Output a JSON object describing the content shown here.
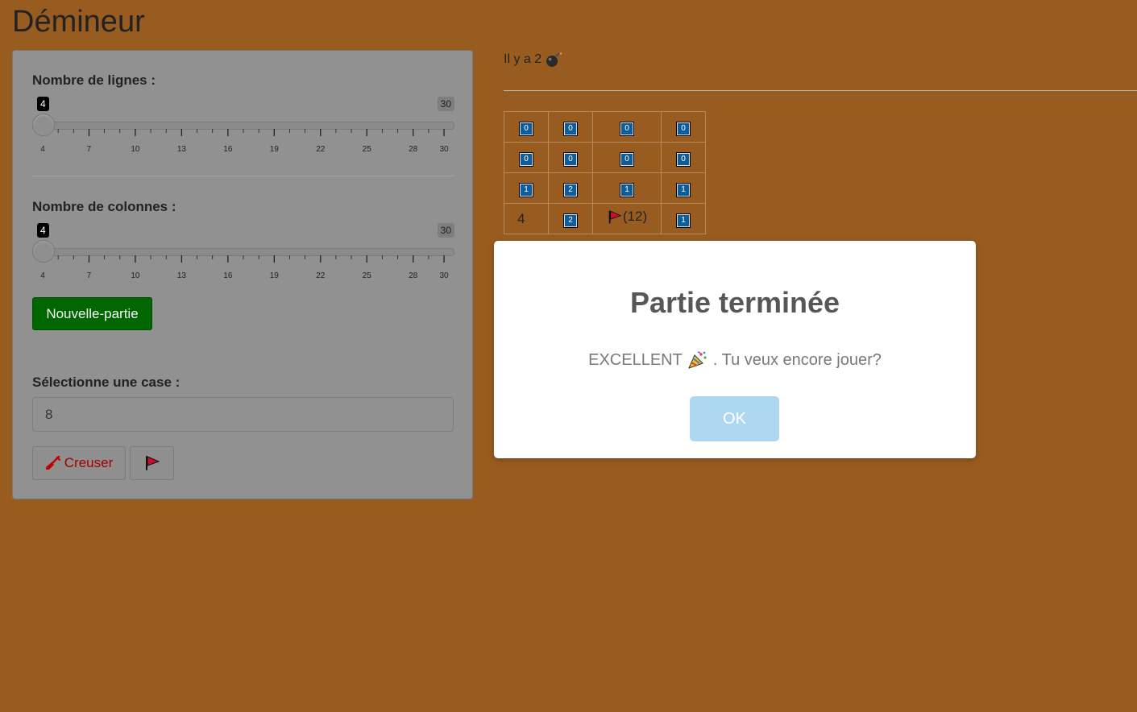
{
  "app": {
    "title": "Démineur"
  },
  "sidebar": {
    "rows_label": "Nombre de lignes :",
    "rows_slider": {
      "min": 4,
      "max": 30,
      "value": 4,
      "value_label": "4",
      "max_label": "30",
      "ticks": [
        "4",
        "7",
        "10",
        "13",
        "16",
        "19",
        "22",
        "25",
        "28",
        "30"
      ]
    },
    "cols_label": "Nombre de colonnes :",
    "cols_slider": {
      "min": 4,
      "max": 30,
      "value": 4,
      "value_label": "4",
      "max_label": "30",
      "ticks": [
        "4",
        "7",
        "10",
        "13",
        "16",
        "19",
        "22",
        "25",
        "28",
        "30"
      ]
    },
    "new_game_label": "Nouvelle-partie",
    "select_label": "Sélectionne une case :",
    "select_value": "8",
    "dig_label": "Creuser",
    "dig_icon": "shovel-icon",
    "flag_icon": "flag-icon"
  },
  "board": {
    "bomb_text": "Il y a 2",
    "bomb_icon": "bomb-icon",
    "rows": [
      [
        {
          "type": "box",
          "v": "0"
        },
        {
          "type": "box",
          "v": "0"
        },
        {
          "type": "box",
          "v": "0"
        },
        {
          "type": "box",
          "v": "0"
        }
      ],
      [
        {
          "type": "box",
          "v": "0"
        },
        {
          "type": "box",
          "v": "0"
        },
        {
          "type": "box",
          "v": "0"
        },
        {
          "type": "box",
          "v": "0"
        }
      ],
      [
        {
          "type": "box",
          "v": "1"
        },
        {
          "type": "box",
          "v": "2"
        },
        {
          "type": "box",
          "v": "1"
        },
        {
          "type": "box",
          "v": "1"
        }
      ],
      [
        {
          "type": "plain",
          "v": "4"
        },
        {
          "type": "box",
          "v": "2"
        },
        {
          "type": "flag",
          "v": "(12)"
        },
        {
          "type": "box",
          "v": "1"
        }
      ]
    ]
  },
  "modal": {
    "title": "Partie terminée",
    "text_before": "EXCELLENT",
    "text_after": ". Tu veux encore jouer?",
    "icon": "party-popper-icon",
    "ok_label": "OK",
    "ok_color": "#aed8f2"
  },
  "colors": {
    "background": "#995c20",
    "new_game": "#006600",
    "cell": "#0d5d9a",
    "dig": "#a50000"
  }
}
